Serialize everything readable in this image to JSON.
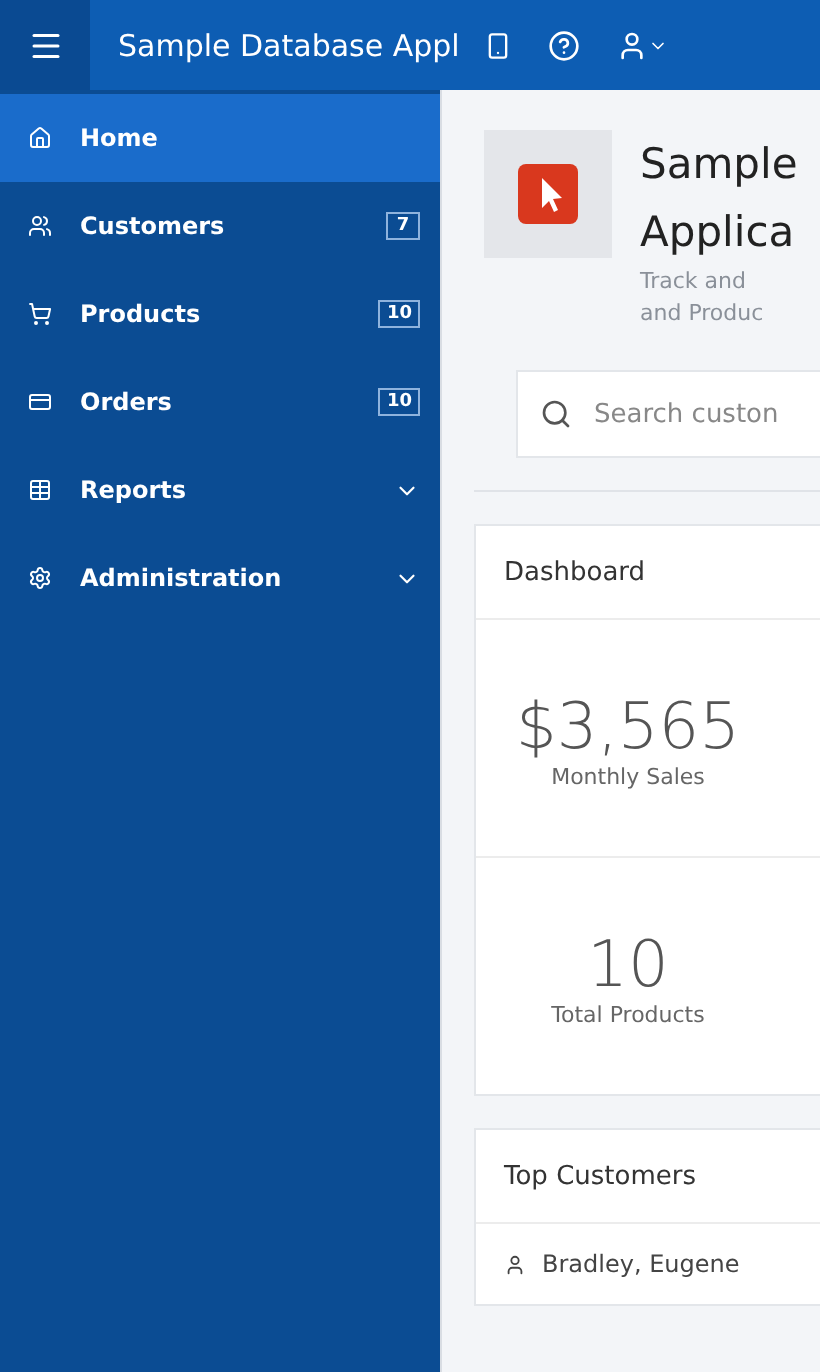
{
  "header": {
    "title": "Sample Database Appl"
  },
  "sidebar": {
    "items": [
      {
        "label": "Home",
        "kind": "link",
        "selected": true
      },
      {
        "label": "Customers",
        "kind": "link",
        "badge": "7",
        "selected": false
      },
      {
        "label": "Products",
        "kind": "link",
        "badge": "10",
        "selected": false
      },
      {
        "label": "Orders",
        "kind": "link",
        "badge": "10",
        "selected": false
      },
      {
        "label": "Reports",
        "kind": "group",
        "selected": false
      },
      {
        "label": "Administration",
        "kind": "group",
        "selected": false
      }
    ]
  },
  "hero": {
    "title_lines": [
      "Sample",
      "Applica"
    ],
    "description_lines": [
      "Track and",
      "and Produc"
    ]
  },
  "search": {
    "placeholder": "Search custon"
  },
  "dashboard": {
    "title": "Dashboard",
    "metrics": [
      {
        "value": "$3,565",
        "label": "Monthly Sales"
      },
      {
        "value": "10",
        "label": "Total Products"
      }
    ]
  },
  "top_customers": {
    "title": "Top Customers",
    "rows": [
      "Bradley, Eugene"
    ]
  }
}
